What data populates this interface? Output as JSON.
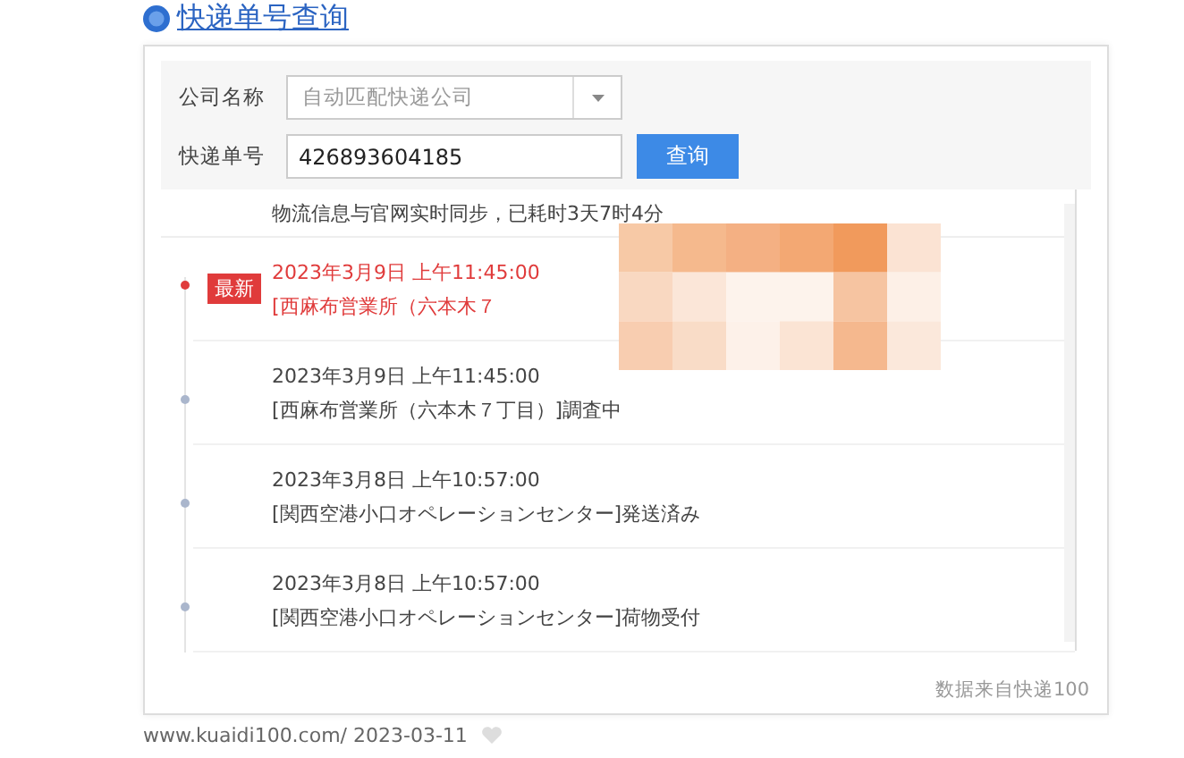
{
  "title": "快递单号查询",
  "form": {
    "company_label": "公司名称",
    "company_placeholder": "自动匹配快递公司",
    "number_label": "快递单号",
    "number_value": "426893604185",
    "query_button": "查询"
  },
  "sync_note": "物流信息与官网实时同步，已耗时3天7时4分",
  "events": [
    {
      "time": "2023年3月9日 上午11:45:00",
      "detail": "[西麻布営業所（六本木７",
      "latest": true,
      "badge": "最新",
      "redacted": true
    },
    {
      "time": "2023年3月9日 上午11:45:00",
      "detail": "[西麻布営業所（六本木７丁目）]調査中",
      "latest": false,
      "redacted": false
    },
    {
      "time": "2023年3月8日 上午10:57:00",
      "detail": "[関西空港小口オペレーションセンター]発送済み",
      "latest": false,
      "redacted": false
    },
    {
      "time": "2023年3月8日 上午10:57:00",
      "detail": "[関西空港小口オペレーションセンター]荷物受付",
      "latest": false,
      "redacted": false
    }
  ],
  "source": "数据来自快递100",
  "footer": "www.kuaidi100.com/ 2023-03-11"
}
